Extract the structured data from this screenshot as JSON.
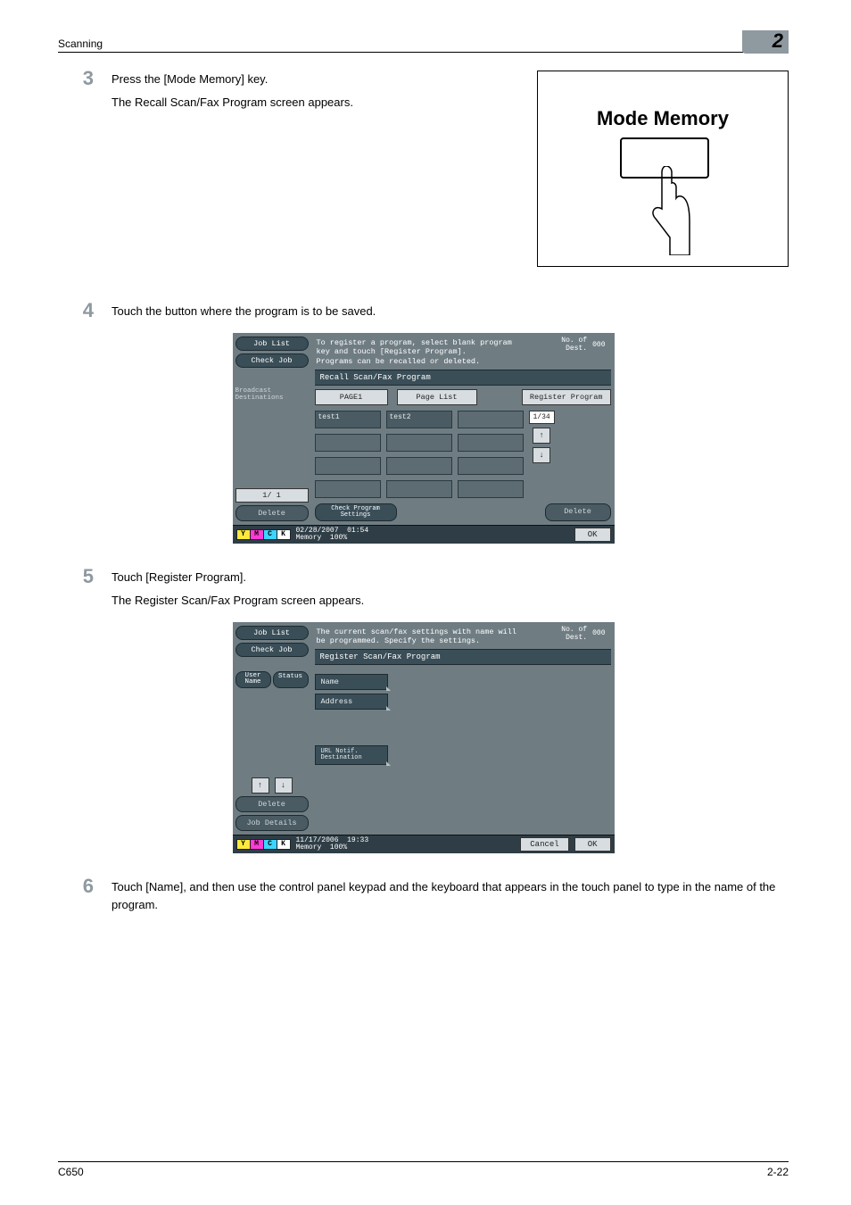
{
  "header": {
    "section": "Scanning",
    "chapter": "2"
  },
  "footer": {
    "model": "C650",
    "page": "2-22"
  },
  "mode_memory": {
    "title": "Mode Memory"
  },
  "steps": {
    "3": {
      "num": "3",
      "line1": "Press the [Mode Memory] key.",
      "line2": "The Recall Scan/Fax Program screen appears."
    },
    "4": {
      "num": "4",
      "line1": "Touch the button where the program is to be saved."
    },
    "5": {
      "num": "5",
      "line1": "Touch [Register Program].",
      "line2": "The Register Scan/Fax Program screen appears."
    },
    "6": {
      "num": "6",
      "line1": "Touch [Name], and then use the control panel keypad and the keyboard that appears in the touch panel to type in the name of the program."
    }
  },
  "screen1": {
    "sidebar": {
      "job_list": "Job List",
      "check_job": "Check Job",
      "broadcast": "Broadcast\nDestinations",
      "page_indicator": "1/  1",
      "delete": "Delete"
    },
    "message": "To register a program, select blank program\nkey and touch [Register Program].\nPrograms can be recalled or deleted.",
    "dest_label": "No. of\nDest.",
    "dest_count": "000",
    "tab": "Recall Scan/Fax Program",
    "page1": "PAGE1",
    "page_list": "Page List",
    "register": "Register Program",
    "slots": [
      "test1",
      "test2"
    ],
    "pager": "1/34",
    "check_settings": "Check Program\nSettings",
    "delete_btn": "Delete",
    "date": "02/28/2007",
    "time": "01:54",
    "mem_label": "Memory",
    "mem_pct": "100%",
    "ok": "OK"
  },
  "screen2": {
    "sidebar": {
      "job_list": "Job List",
      "check_job": "Check Job",
      "user_name": "User\nName",
      "status": "Status",
      "delete": "Delete",
      "job_details": "Job Details"
    },
    "message": "The current scan/fax settings with name will\nbe programmed. Specify the settings.",
    "dest_label": "No. of\nDest.",
    "dest_count": "000",
    "tab": "Register Scan/Fax Program",
    "name": "Name",
    "address": "Address",
    "url": "URL Notif.\nDestination",
    "date": "11/17/2006",
    "time": "19:33",
    "mem_label": "Memory",
    "mem_pct": "100%",
    "cancel": "Cancel",
    "ok": "OK"
  }
}
